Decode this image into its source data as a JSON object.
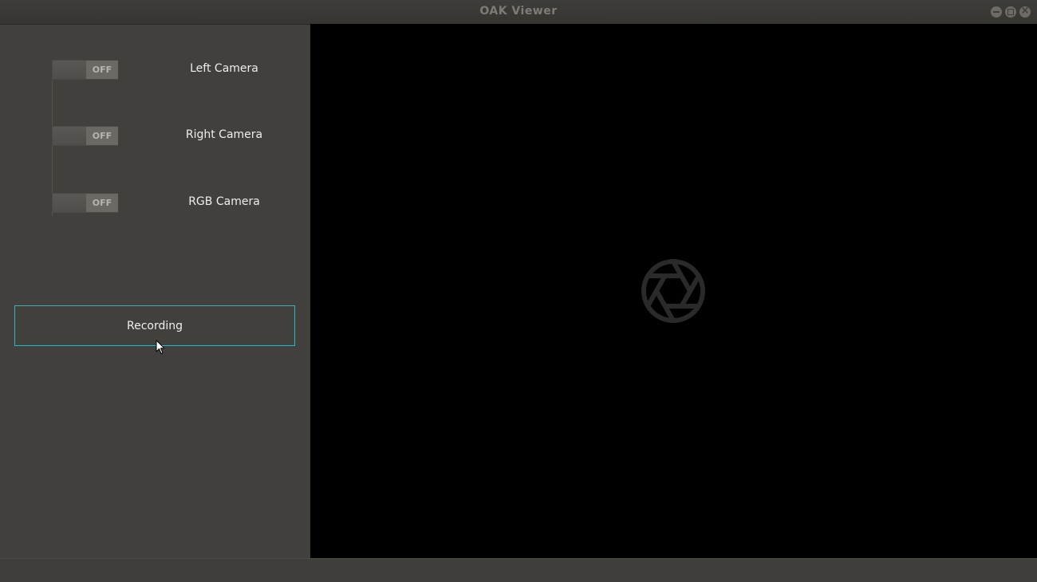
{
  "window": {
    "title": "OAK Viewer"
  },
  "sidebar": {
    "toggles": [
      {
        "label": "Left Camera",
        "state": "OFF"
      },
      {
        "label": "Right Camera",
        "state": "OFF"
      },
      {
        "label": "RGB Camera",
        "state": "OFF"
      }
    ],
    "record_label": "Recording"
  },
  "colors": {
    "accent": "#2ab5c8",
    "viewer_bg": "#000000",
    "panel_bg": "#41403c"
  },
  "icons": {
    "viewer_placeholder": "camera-shutter-icon",
    "cursor": "mouse-pointer-icon"
  }
}
